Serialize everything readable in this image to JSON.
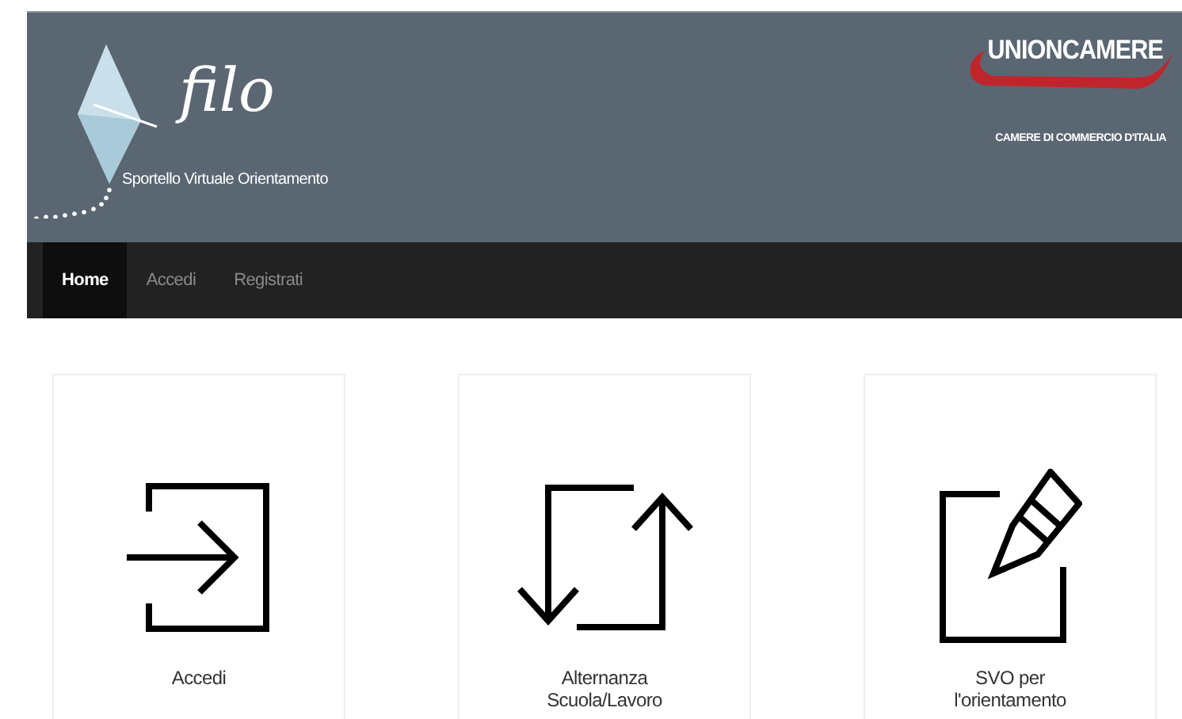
{
  "header": {
    "logo_text": "filo",
    "subtitle": "Sportello Virtuale Orientamento",
    "partner_name": "UNIONCAMERE",
    "partner_tagline": "CAMERE DI COMMERCIO D'ITALIA"
  },
  "nav": [
    {
      "label": "Home",
      "selected": true
    },
    {
      "label": "Accedi",
      "selected": false
    },
    {
      "label": "Registrati",
      "selected": false
    }
  ],
  "cards": [
    {
      "kind": "login",
      "label": "Accedi"
    },
    {
      "kind": "exchange",
      "label": "Alternanza Scuola/Lavoro"
    },
    {
      "kind": "edit",
      "label": "SVO per l'orientamento"
    }
  ]
}
